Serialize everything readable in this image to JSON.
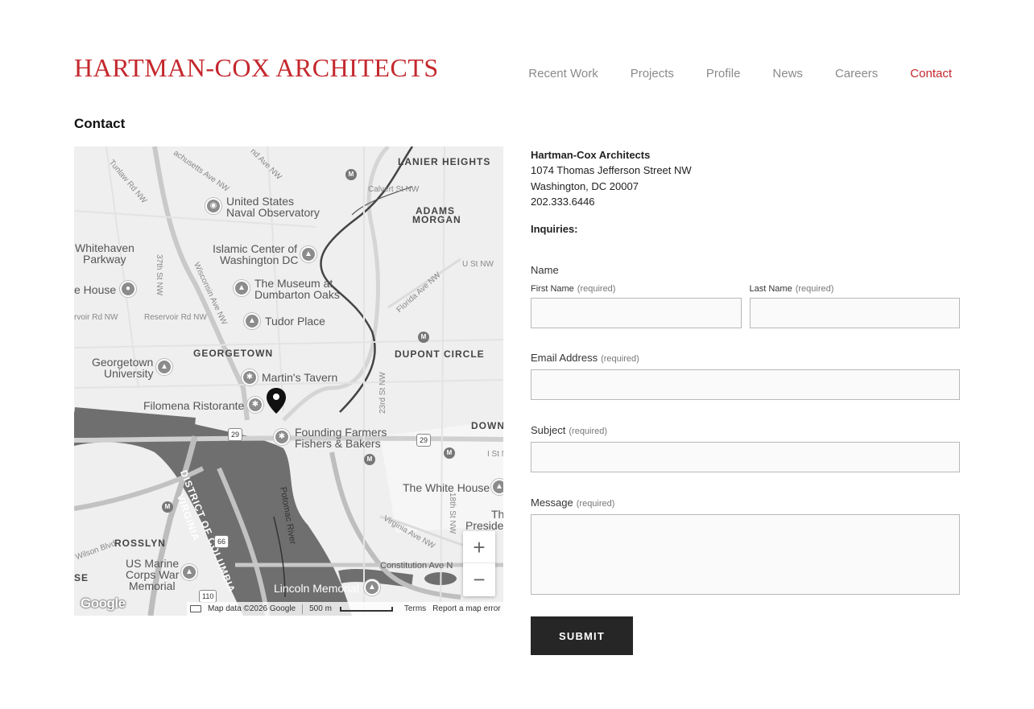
{
  "header": {
    "logo": "HARTMAN-COX ARCHITECTS",
    "nav": [
      "Recent Work",
      "Projects",
      "Profile",
      "News",
      "Careers",
      "Contact"
    ]
  },
  "page_title": "Contact",
  "map": {
    "labels": {
      "lanier_heights": "LANIER HEIGHTS",
      "adams_morgan_1": "ADAMS",
      "adams_morgan_2": "MORGAN",
      "naval_obs_1": "United States",
      "naval_obs_2": "Naval Observatory",
      "whitehaven_1": "Whitehaven",
      "whitehaven_2": "Parkway",
      "islamic_1": "Islamic Center of",
      "islamic_2": "Washington DC",
      "dumbarton_1": "The Museum at",
      "dumbarton_2": "Dumbarton Oaks",
      "ehouse": "e House",
      "tudor": "Tudor Place",
      "georgetown": "GEORGETOWN",
      "dupont": "DUPONT CIRCLE",
      "gu_1": "Georgetown",
      "gu_2": "University",
      "martins": "Martin's Tavern",
      "filomena": "Filomena Ristorante",
      "farmers_1": "Founding Farmers",
      "farmers_2": "Fishers & Bakers",
      "down": "DOWN",
      "white_house": "The White House",
      "district": "DISTRICT OF COLUMBIA",
      "virginia": "VIRGINIA",
      "rosslyn": "ROSSLYN",
      "marine_1": "US Marine",
      "marine_2": "Corps War",
      "marine_3": "Memorial",
      "se": "SE",
      "lincoln": "Lincoln Memorial",
      "constitution": "Constitution Ave N",
      "presid_1": "Th",
      "presid_2": "Preside",
      "potomac": "Potomac River",
      "st_tunlaw": "Tunlaw Rd NW",
      "st_mass": "Massachusetts Ave NW",
      "st_wisc": "Wisconsin Ave NW",
      "st_37": "37th St NW",
      "st_reservoir": "Reservoir Rd NW",
      "st_reservoir2": "rvoir Rd NW",
      "st_calvert": "Calvert St NW",
      "st_u": "U St NW",
      "st_florida": "Florida Ave NW",
      "st_23": "23rd St NW",
      "st_18": "18th St NW",
      "st_virginia": "Virginia Ave NW",
      "st_wilson": "Wilson Blvd",
      "st_i": "I St N",
      "st_nd": "nd Ave NW",
      "st_sach": "achusetts Ave NW",
      "rt29a": "29",
      "rt29b": "29",
      "rt66": "66",
      "rt110": "110"
    },
    "google": "Google",
    "attribution": {
      "data": "Map data ©2026 Google",
      "scale": "500 m",
      "terms": "Terms",
      "report": "Report a map error"
    },
    "zoom_in": "+",
    "zoom_out": "−"
  },
  "contact": {
    "firm": "Hartman-Cox Architects",
    "address1": "1074 Thomas Jefferson Street NW",
    "address2": "Washington, DC 20007",
    "phone": "202.333.6446",
    "inquiries": "Inquiries:"
  },
  "form": {
    "name_label": "Name",
    "first_name": "First Name",
    "last_name": "Last Name",
    "required": "(required)",
    "email_label": "Email Address",
    "subject_label": "Subject",
    "message_label": "Message",
    "submit": "SUBMIT"
  },
  "colors": {
    "accent": "#c4282e",
    "nav_text": "#8a8a8a",
    "button_bg": "#262626",
    "river": "#707070"
  },
  "icons": {
    "map_pin": "map-marker-icon",
    "poi": "poi-icon",
    "metro": "metro-icon",
    "keyboard": "keyboard-icon"
  }
}
